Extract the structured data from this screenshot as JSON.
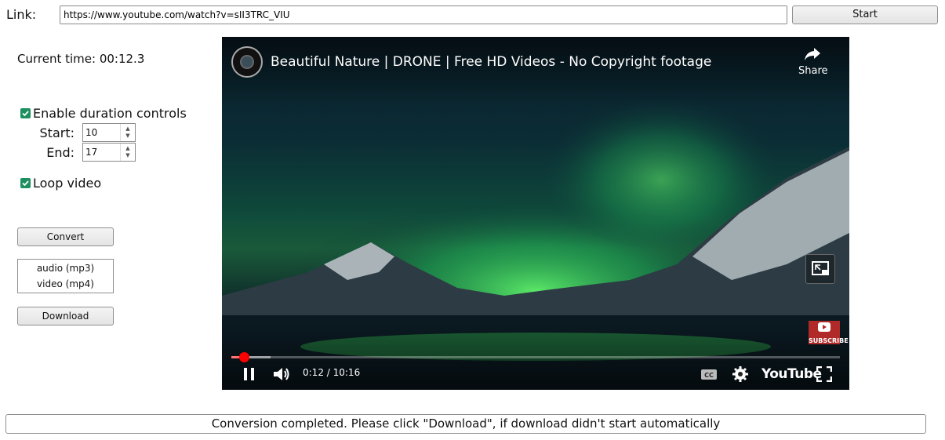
{
  "link": {
    "label": "Link:",
    "value": "https://www.youtube.com/watch?v=sII3TRC_VIU"
  },
  "start_button": "Start",
  "current_time": "Current time: 00:12.3",
  "duration": {
    "enable_label": "Enable duration controls",
    "enabled": true,
    "start_label": "Start:",
    "start_value": "10",
    "end_label": "End:",
    "end_value": "17"
  },
  "loop": {
    "label": "Loop video",
    "enabled": true
  },
  "convert_button": "Convert",
  "formats": [
    "audio (mp3)",
    "video (mp4)"
  ],
  "download_button": "Download",
  "video": {
    "title": "Beautiful Nature | DRONE | Free HD Videos - No Copyright footage",
    "share_label": "Share",
    "time": "0:12 / 10:16",
    "progress": 0.02,
    "youtube_label": "YouTube",
    "subscribe_label": "SUBSCRIBE"
  },
  "status": "Conversion completed. Please click \"Download\", if download didn't start automatically"
}
